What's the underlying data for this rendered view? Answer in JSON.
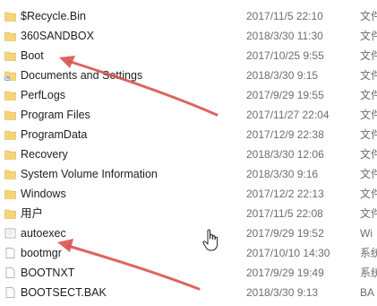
{
  "colors": {
    "folder": "#f6d57a",
    "folder_dark": "#d8b54a",
    "annotation_arrow": "#d9534f",
    "text": "#1e1e1e",
    "meta_text": "#6d6d6d"
  },
  "items": [
    {
      "name": "$Recycle.Bin",
      "date": "2017/11/5 22:10",
      "type": "文件",
      "icon": "folder-icon"
    },
    {
      "name": "360SANDBOX",
      "date": "2018/3/30 11:30",
      "type": "文件",
      "icon": "folder-icon"
    },
    {
      "name": "Boot",
      "date": "2017/10/25 9:55",
      "type": "文件",
      "icon": "folder-icon"
    },
    {
      "name": "Documents and Settings",
      "date": "2018/3/30 9:15",
      "type": "文件",
      "icon": "folder-shortcut-icon"
    },
    {
      "name": "PerfLogs",
      "date": "2017/9/29 19:55",
      "type": "文件",
      "icon": "folder-icon"
    },
    {
      "name": "Program Files",
      "date": "2017/11/27 22:04",
      "type": "文件",
      "icon": "folder-icon"
    },
    {
      "name": "ProgramData",
      "date": "2017/12/9 22:38",
      "type": "文件",
      "icon": "folder-icon"
    },
    {
      "name": "Recovery",
      "date": "2018/3/30 12:06",
      "type": "文件",
      "icon": "folder-icon"
    },
    {
      "name": "System Volume Information",
      "date": "2018/3/30 9:16",
      "type": "文件",
      "icon": "folder-icon"
    },
    {
      "name": "Windows",
      "date": "2017/12/2 22:13",
      "type": "文件",
      "icon": "folder-icon"
    },
    {
      "name": "用户",
      "date": "2017/11/5 22:08",
      "type": "文件",
      "icon": "folder-icon"
    },
    {
      "name": "autoexec",
      "date": "2017/9/29 19:52",
      "type": "Wi",
      "icon": "file-icon"
    },
    {
      "name": "bootmgr",
      "date": "2017/10/10 14:30",
      "type": "系统",
      "icon": "file-icon"
    },
    {
      "name": "BOOTNXT",
      "date": "2017/9/29 19:49",
      "type": "系统",
      "icon": "file-icon"
    },
    {
      "name": "BOOTSECT.BAK",
      "date": "2018/3/30 9:13",
      "type": "BA",
      "icon": "file-icon"
    }
  ]
}
